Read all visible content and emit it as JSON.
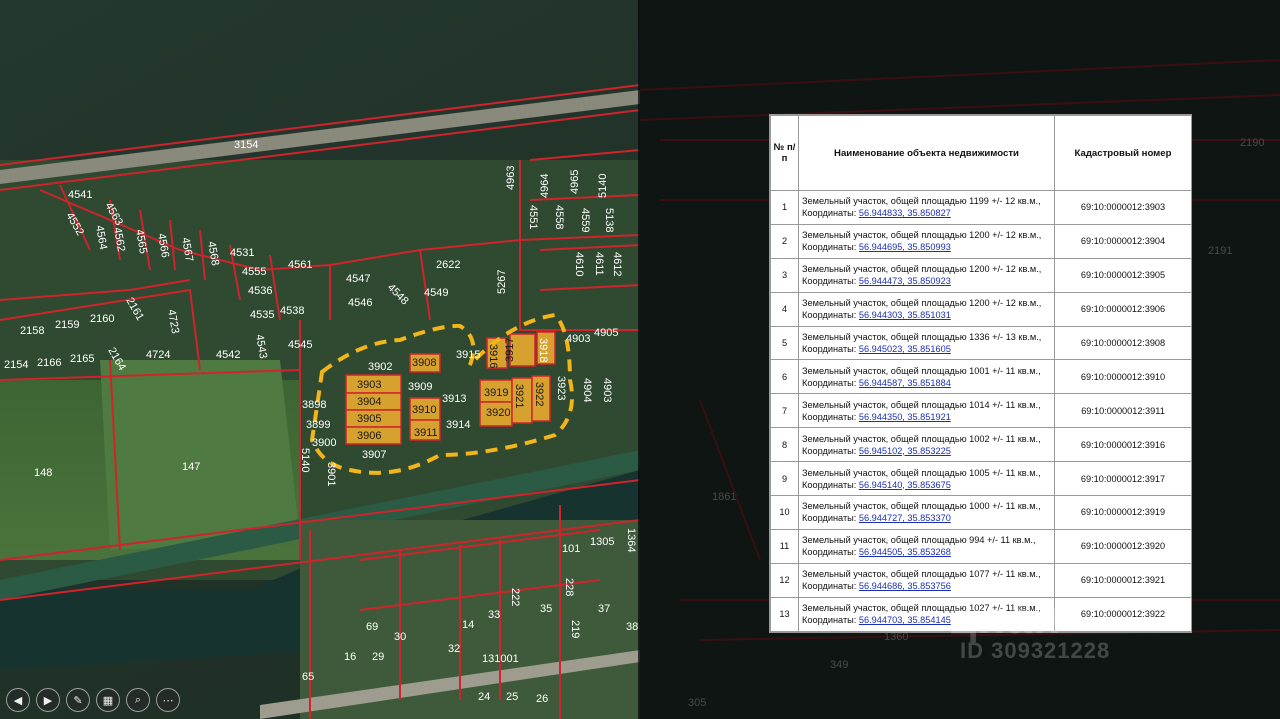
{
  "map": {
    "parcel_labels": [
      "3154",
      "4541",
      "4563",
      "4552",
      "4564",
      "4562",
      "4565",
      "4566",
      "4567",
      "4568",
      "4531",
      "4555",
      "4561",
      "4536",
      "4547",
      "2622",
      "4548",
      "4549",
      "4546",
      "4535",
      "4538",
      "4545",
      "4543",
      "4542",
      "2158",
      "2159",
      "2160",
      "2161",
      "4723",
      "2154",
      "2166",
      "2165",
      "2164",
      "4724",
      "3902",
      "3908",
      "3915",
      "3916",
      "3917",
      "3918",
      "4903",
      "4905",
      "3903",
      "3904",
      "3905",
      "3906",
      "3909",
      "3910",
      "3911",
      "3913",
      "3914",
      "3919",
      "3920",
      "3921",
      "3922",
      "3923",
      "3898",
      "3899",
      "3900",
      "3907",
      "3901",
      "5140",
      "148",
      "147",
      "4963",
      "4964",
      "4965",
      "5140",
      "4551",
      "4558",
      "4559",
      "5138",
      "5267",
      "4610",
      "4611",
      "4612",
      "4904",
      "4903",
      "101",
      "1305",
      "1364",
      "228",
      "222",
      "37",
      "219",
      "38",
      "14",
      "33",
      "35",
      "69",
      "30",
      "16",
      "29",
      "32",
      "131001",
      "24",
      "25",
      "26",
      "65",
      "2191",
      "2190",
      "1861",
      "1360",
      "349",
      "305"
    ],
    "highlighted": [
      "3902",
      "3903",
      "3904",
      "3905",
      "3906",
      "3907",
      "3908",
      "3909",
      "3910",
      "3911",
      "3913",
      "3914",
      "3916",
      "3917",
      "3918",
      "3919",
      "3920",
      "3921",
      "3922",
      "3923"
    ]
  },
  "table": {
    "headers": [
      "№ п/п",
      "Наименование объекта недвижимости",
      "Кадастровый номер"
    ],
    "rows": [
      {
        "n": "1",
        "text": "Земельный участок, общей площадью 1199 +/- 12 кв.м.,",
        "coord_label": "Координаты:",
        "coords": "56.944833, 35.850827",
        "cad": "69:10:0000012:3903"
      },
      {
        "n": "2",
        "text": "Земельный участок, общей площадью 1200 +/- 12 кв.м.,",
        "coord_label": "Координаты:",
        "coords": "56.944695, 35.850993",
        "cad": "69:10:0000012:3904"
      },
      {
        "n": "3",
        "text": "Земельный участок, общей площадью 1200 +/- 12 кв.м.,",
        "coord_label": "Координаты:",
        "coords": "56.944473, 35.850923",
        "cad": "69:10:0000012:3905"
      },
      {
        "n": "4",
        "text": "Земельный участок, общей площадью 1200 +/- 12 кв.м.,",
        "coord_label": "Координаты:",
        "coords": "56.944303, 35.851031",
        "cad": "69:10:0000012:3906"
      },
      {
        "n": "5",
        "text": "Земельный участок, общей площадью 1336 +/- 13 кв.м.,",
        "coord_label": "Координаты:",
        "coords": "56.945023, 35.851605",
        "cad": "69:10:0000012:3908"
      },
      {
        "n": "6",
        "text": "Земельный участок, общей площадью 1001 +/- 11 кв.м.,",
        "coord_label": "Координаты:",
        "coords": "56.944587, 35.851884",
        "cad": "69:10:0000012:3910"
      },
      {
        "n": "7",
        "text": "Земельный участок, общей площадью 1014 +/- 11 кв.м.,",
        "coord_label": "Координаты:",
        "coords": "56.944350, 35.851921",
        "cad": "69:10:0000012:3911"
      },
      {
        "n": "8",
        "text": "Земельный участок, общей площадью 1002 +/- 11 кв.м.,",
        "coord_label": "Координаты:",
        "coords": "56.945102, 35.853225",
        "cad": "69:10:0000012:3916"
      },
      {
        "n": "9",
        "text": "Земельный участок, общей площадью 1005 +/- 11 кв.м.,",
        "coord_label": "Координаты:",
        "coords": "56.945140, 35.853675",
        "cad": "69:10:0000012:3917"
      },
      {
        "n": "10",
        "text": "Земельный участок, общей площадью 1000 +/- 11 кв.м.,",
        "coord_label": "Координаты:",
        "coords": "56.944727, 35.853370",
        "cad": "69:10:0000012:3919"
      },
      {
        "n": "11",
        "text": "Земельный участок, общей площадью 994 +/- 11 кв.м.,",
        "coord_label": "Координаты:",
        "coords": "56.944505, 35.853268",
        "cad": "69:10:0000012:3920"
      },
      {
        "n": "12",
        "text": "Земельный участок, общей площадью 1077 +/- 11 кв.м.,",
        "coord_label": "Координаты:",
        "coords": "56.944686, 35.853756",
        "cad": "69:10:0000012:3921"
      },
      {
        "n": "13",
        "text": "Земельный участок, общей площадью 1027 +/- 11 кв.м.,",
        "coord_label": "Координаты:",
        "coords": "56.944703, 35.854145",
        "cad": "69:10:0000012:3922"
      }
    ]
  },
  "watermark": {
    "logo": "циан",
    "id": "ID 309321228"
  },
  "controls": [
    {
      "name": "prev-button",
      "icon": "chevron-left-icon",
      "glyph": "◀"
    },
    {
      "name": "next-button",
      "icon": "chevron-right-icon",
      "glyph": "▶"
    },
    {
      "name": "pen-button",
      "icon": "pen-icon",
      "glyph": "✎"
    },
    {
      "name": "slides-button",
      "icon": "slides-icon",
      "glyph": "▦"
    },
    {
      "name": "zoom-button",
      "icon": "magnifier-icon",
      "glyph": "⌕"
    },
    {
      "name": "more-button",
      "icon": "more-icon",
      "glyph": "⋯"
    }
  ],
  "colors": {
    "boundary": "#d0242c",
    "highlight": "#d6a12e",
    "dash": "#f2b51a",
    "coord_link": "#1a2fb5"
  }
}
